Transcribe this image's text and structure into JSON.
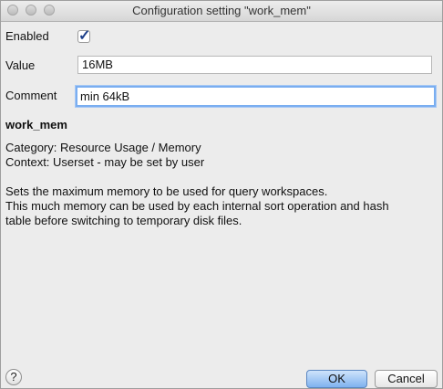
{
  "window": {
    "title": "Configuration setting \"work_mem\""
  },
  "form": {
    "enabled_label": "Enabled",
    "enabled_checked": true,
    "value_label": "Value",
    "value": "16MB",
    "comment_label": "Comment",
    "comment": "min 64kB"
  },
  "info": {
    "name": "work_mem",
    "category": "Category: Resource Usage / Memory",
    "context": "Context: Userset - may be set by user",
    "desc_line1": "Sets the maximum memory to be used for query workspaces.",
    "desc_line2": "This much memory can be used by each internal sort operation and hash",
    "desc_line3": "table before switching to temporary disk files."
  },
  "buttons": {
    "help": "?",
    "ok": "OK",
    "cancel": "Cancel"
  }
}
